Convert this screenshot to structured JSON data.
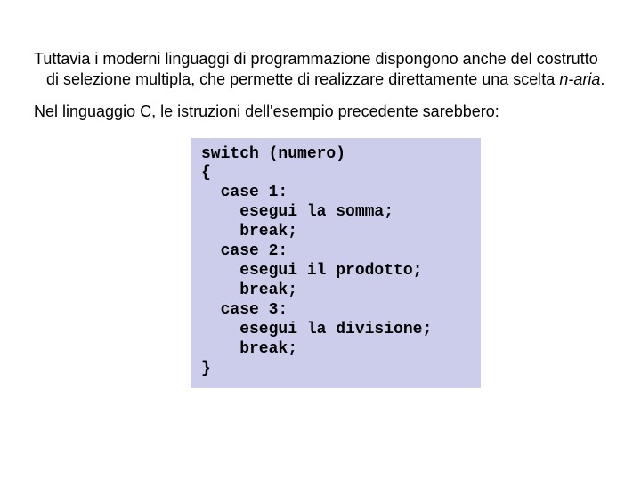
{
  "paragraphs": {
    "p1_a": "Tuttavia i moderni linguaggi di programmazione dispongono anche del costrutto di selezione multipla, che permette di realizzare direttamente una scelta ",
    "p1_i": "n-aria",
    "p1_b": ".",
    "p2": "Nel linguaggio C, le istruzioni dell'esempio precedente sarebbero:"
  },
  "code": "switch (numero)\n{\n  case 1:\n    esegui la somma;\n    break;\n  case 2:\n    esegui il prodotto;\n    break;\n  case 3:\n    esegui la divisione;\n    break;\n}"
}
